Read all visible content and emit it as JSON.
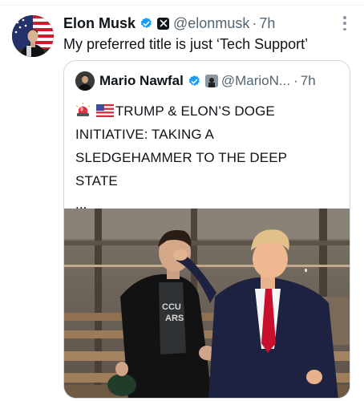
{
  "post": {
    "author_name": "Elon Musk",
    "author_handle": "@elonmusk",
    "time": "7h",
    "separator": "·",
    "text": "My preferred title is just ‘Tech Support’"
  },
  "quoted_post": {
    "author_name": "Mario Nawfal",
    "author_handle": "@MarioN...",
    "time": "7h",
    "separator": "·",
    "text_lines": [
      "TRUMP & ELON’S DOGE",
      "INITIATIVE: TAKING A",
      "SLEDGEHAMMER TO THE DEEP",
      "STATE",
      "..."
    ],
    "emojis": [
      "siren-emoji",
      "us-flag-emoji"
    ],
    "image": {
      "shirt_text_line1": "CCU",
      "shirt_text_line2": "ARS"
    }
  },
  "colors": {
    "text_primary": "#0f1419",
    "text_secondary": "#536471",
    "verified_blue": "#1d9bf0",
    "border": "#cfd9de"
  }
}
